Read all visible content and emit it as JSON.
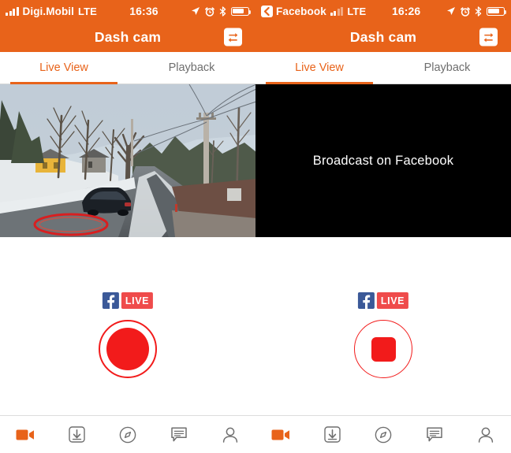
{
  "app": {
    "accent_color": "#E8631A",
    "record_color": "#f21b1b",
    "facebook_blue": "#3b5998",
    "live_red": "#ef4b4b"
  },
  "panels": [
    {
      "status_bar": {
        "carrier": "Digi.Mobil",
        "network": "LTE",
        "time": "16:36",
        "signal_icon": "signal-bars-icon",
        "location_icon": "location-arrow-icon",
        "alarm_icon": "alarm-clock-icon",
        "bluetooth_icon": "bluetooth-icon",
        "battery_icon": "battery-icon",
        "back_app": null
      },
      "title_bar": {
        "title": "Dash cam",
        "action_icon": "swap-arrows-icon"
      },
      "tabs": [
        {
          "label": "Live View",
          "active": true
        },
        {
          "label": "Playback",
          "active": false
        }
      ],
      "stage": {
        "mode": "video",
        "placeholder_text": "",
        "video_description": "Dash cam live view of a snowy mountain road with bare trees, a yellow house, a dark parked car and utility poles"
      },
      "controls": {
        "facebook_icon": "facebook-f-icon",
        "live_label": "LIVE",
        "button_state": "record",
        "button_name": "record-button"
      },
      "toolbar": [
        {
          "icon": "video-camera-icon",
          "active": true
        },
        {
          "icon": "download-icon",
          "active": false
        },
        {
          "icon": "compass-icon",
          "active": false
        },
        {
          "icon": "chat-bubble-icon",
          "active": false
        },
        {
          "icon": "person-icon",
          "active": false
        }
      ]
    },
    {
      "status_bar": {
        "carrier": "Facebook",
        "network": "LTE",
        "time": "16:26",
        "signal_icon": "signal-bars-icon",
        "location_icon": "location-arrow-icon",
        "alarm_icon": "alarm-clock-icon",
        "bluetooth_icon": "bluetooth-icon",
        "battery_icon": "battery-icon",
        "back_app": "Facebook"
      },
      "title_bar": {
        "title": "Dash cam",
        "action_icon": "swap-arrows-icon"
      },
      "tabs": [
        {
          "label": "Live View",
          "active": true
        },
        {
          "label": "Playback",
          "active": false
        }
      ],
      "stage": {
        "mode": "placeholder",
        "placeholder_text": "Broadcast on Facebook",
        "video_description": ""
      },
      "controls": {
        "facebook_icon": "facebook-f-icon",
        "live_label": "LIVE",
        "button_state": "stop",
        "button_name": "stop-button"
      },
      "toolbar": [
        {
          "icon": "video-camera-icon",
          "active": true
        },
        {
          "icon": "download-icon",
          "active": false
        },
        {
          "icon": "compass-icon",
          "active": false
        },
        {
          "icon": "chat-bubble-icon",
          "active": false
        },
        {
          "icon": "person-icon",
          "active": false
        }
      ]
    }
  ]
}
